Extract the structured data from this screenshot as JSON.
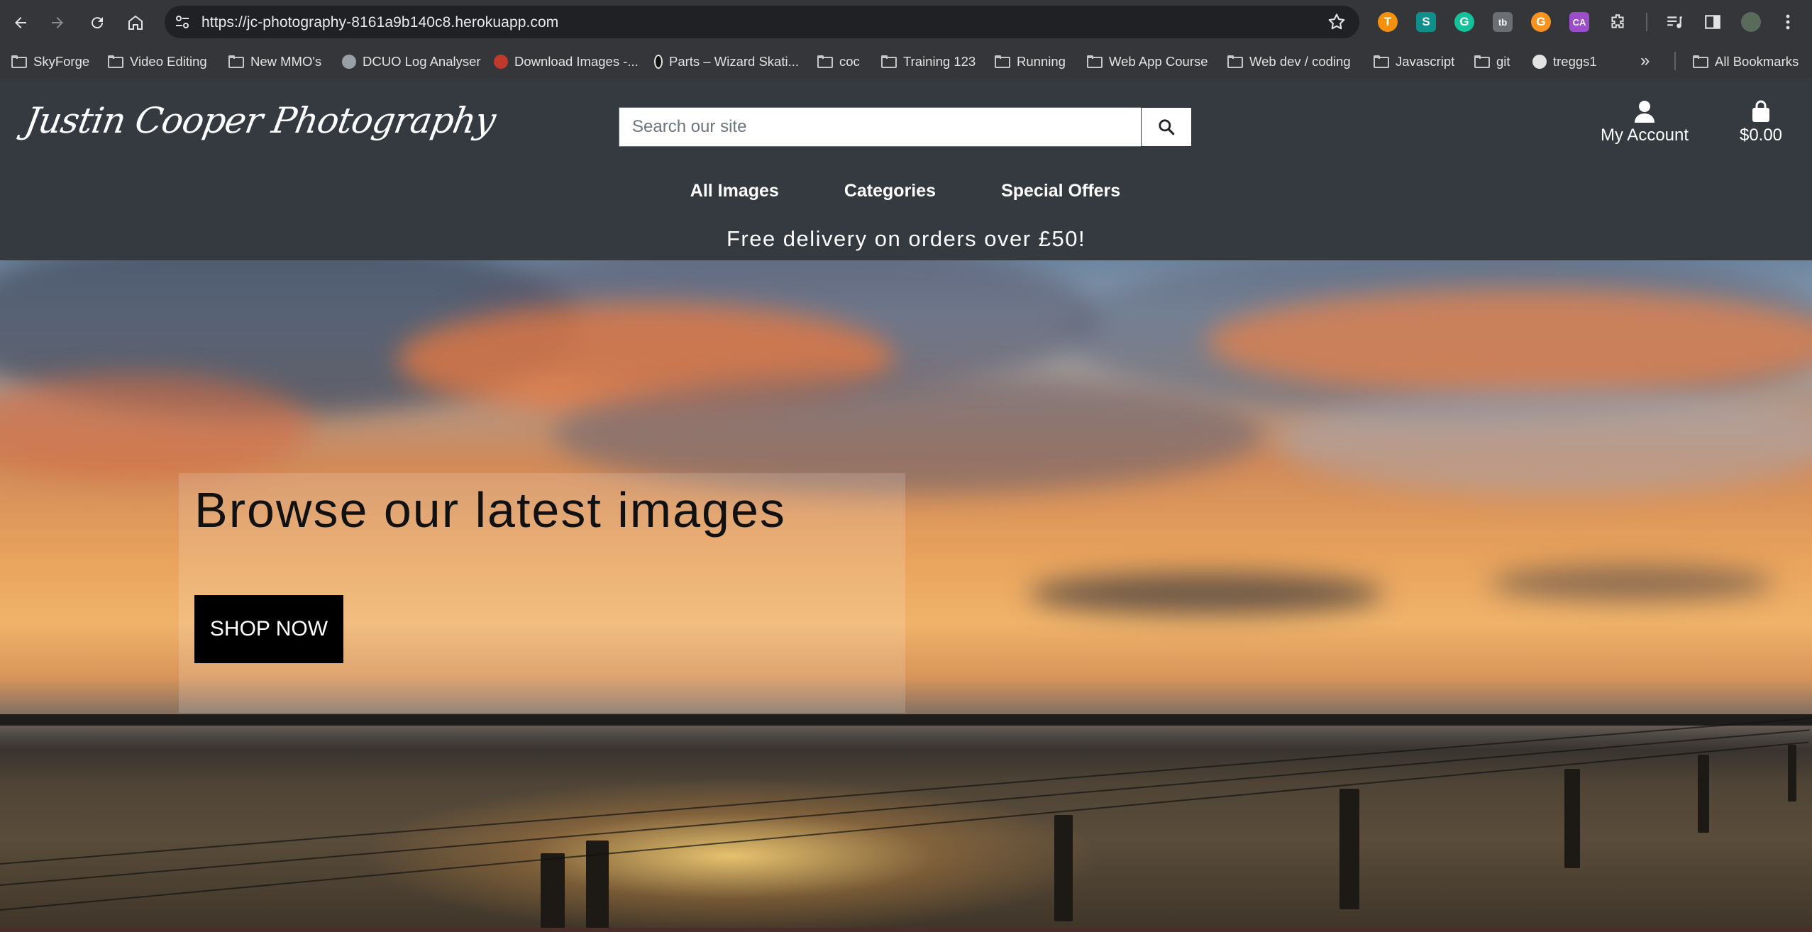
{
  "browser": {
    "url": "https://jc-photography-8161a9b140c8.herokuapp.com",
    "bookmarks": [
      {
        "label": "SkyForge",
        "icon": "folder-icon"
      },
      {
        "label": "Video Editing",
        "icon": "folder-icon"
      },
      {
        "label": "New MMO's",
        "icon": "folder-icon"
      },
      {
        "label": "DCUO Log Analyser",
        "icon": "globe-icon"
      },
      {
        "label": "Download Images -...",
        "icon": "site-favicon"
      },
      {
        "label": "Parts – Wizard Skati...",
        "icon": "site-favicon"
      },
      {
        "label": "coc",
        "icon": "folder-icon"
      },
      {
        "label": "Training 123",
        "icon": "folder-icon"
      },
      {
        "label": "Running",
        "icon": "folder-icon"
      },
      {
        "label": "Web App Course",
        "icon": "folder-icon"
      },
      {
        "label": "Web dev / coding",
        "icon": "folder-icon"
      },
      {
        "label": "Javascript",
        "icon": "folder-icon"
      },
      {
        "label": "git",
        "icon": "folder-icon"
      },
      {
        "label": "treggs1",
        "icon": "github-icon"
      }
    ],
    "overflow_label": "»",
    "all_bookmarks": "All Bookmarks",
    "extensions": [
      {
        "name": "t-extension-icon",
        "glyph": "T",
        "color": "#f4900c"
      },
      {
        "name": "s-extension-icon",
        "glyph": "S",
        "color": "#0f8f8c"
      },
      {
        "name": "grammarly-icon",
        "glyph": "G",
        "color": "#15c39a"
      },
      {
        "name": "tb-extension-icon",
        "glyph": "tb",
        "color": "#6b6e73"
      },
      {
        "name": "g-extension-icon",
        "glyph": "G",
        "color": "#f7931e"
      },
      {
        "name": "ca-extension-icon",
        "glyph": "CA",
        "color": "#9b4dca"
      }
    ]
  },
  "site": {
    "logo": "Justin Cooper Photography",
    "search_placeholder": "Search our site",
    "account_label": "My Account",
    "bag_total": "$0.00",
    "nav": [
      "All Images",
      "Categories",
      "Special Offers"
    ],
    "delivery_banner": "Free delivery on orders over £50!"
  },
  "hero": {
    "title": "Browse our latest images",
    "cta": "SHOP NOW"
  }
}
